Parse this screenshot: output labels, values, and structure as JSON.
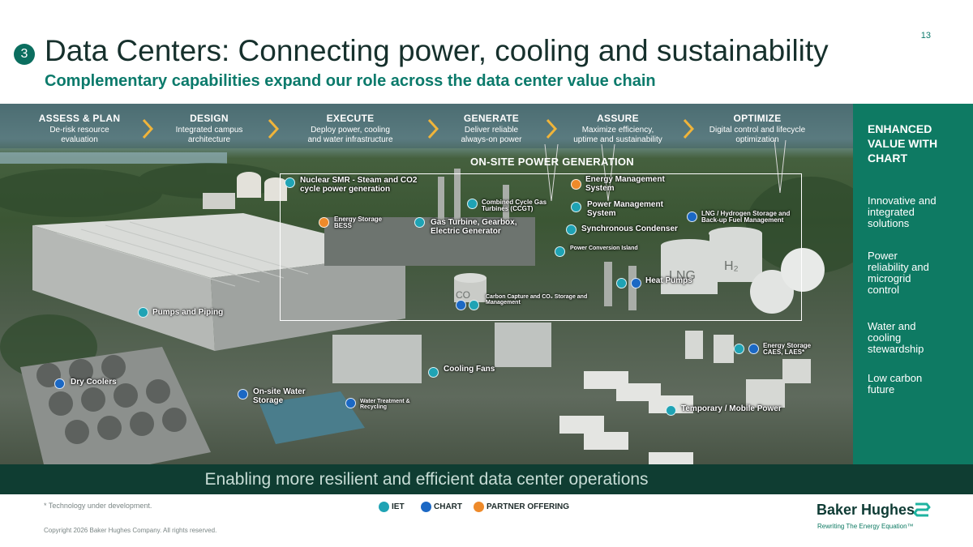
{
  "page_number": "13",
  "section_number": "3",
  "title": "Data Centers: Connecting power, cooling and sustainability",
  "subtitle": "Complementary capabilities expand our role across the data center value chain",
  "steps": [
    {
      "label": "ASSESS & PLAN",
      "desc1": "De-risk resource",
      "desc2": "evaluation"
    },
    {
      "label": "DESIGN",
      "desc1": "Integrated campus",
      "desc2": "architecture"
    },
    {
      "label": "EXECUTE",
      "desc1": "Deploy power, cooling",
      "desc2": "and water infrastructure"
    },
    {
      "label": "GENERATE",
      "desc1": "Deliver reliable",
      "desc2": "always-on power"
    },
    {
      "label": "ASSURE",
      "desc1": "Maximize efficiency,",
      "desc2": "uptime and sustainability"
    },
    {
      "label": "OPTIMIZE",
      "desc1": "Digital control and lifecycle",
      "desc2": "optimization"
    }
  ],
  "onsite_title": "ON-SITE POWER GENERATION",
  "labels": {
    "nuclear_1": "Nuclear SMR -  Steam and CO2",
    "nuclear_2": "cycle power generation",
    "ccgt_1": "Combined Cycle Gas",
    "ccgt_2": "Turbines (CCGT)",
    "ems_1": "Energy Management",
    "ems_2": "System",
    "pms_1": "Power Management",
    "pms_2": "System",
    "lng_1": "LNG / Hydrogen Storage and",
    "lng_2": "Back-up Fuel Management",
    "bess_1": "Energy Storage",
    "bess_2": "BESS",
    "gas_turbine_1": "Gas Turbine, Gearbox,",
    "gas_turbine_2": "Electric Generator",
    "sync_condenser": "Synchronous Condenser",
    "power_island": "Power Conversion Island",
    "heat_pumps": "Heat Pumps",
    "ccs_1": "Carbon Capture and CO₂ Storage and",
    "ccs_2": "Management",
    "pumps_piping": "Pumps and Piping",
    "energy_storage_caes_1": "Energy Storage",
    "energy_storage_caes_2": "CAES, LAES*",
    "cooling_fans": "Cooling Fans",
    "dry_coolers": "Dry Coolers",
    "water_storage_1": "On-site Water",
    "water_storage_2": "Storage",
    "water_treatment_1": "Water Treatment &",
    "water_treatment_2": "Recycling",
    "temp_power": "Temporary / Mobile Power"
  },
  "scene_texts": {
    "lng_tank": "LNG",
    "h2_tank": "H₂",
    "co_tank": "CO"
  },
  "bottom_banner": "Enabling more resilient and efficient data center operations",
  "side_panel": {
    "heading_1": "ENHANCED",
    "heading_2": "VALUE WITH",
    "heading_3": "CHART",
    "items": [
      [
        "Innovative and",
        "integrated",
        "solutions"
      ],
      [
        "Power",
        "reliability and",
        "microgrid",
        "control"
      ],
      [
        "Water and",
        "cooling",
        "stewardship"
      ],
      [
        "Low carbon",
        "future"
      ]
    ]
  },
  "footnote": "* Technology under development.",
  "legend": {
    "iet": "IET",
    "chart": "CHART",
    "partner": "PARTNER OFFERING"
  },
  "legend_colors": {
    "iet": "#1fa3b4",
    "chart": "#1b68c4",
    "partner": "#ee8a2a"
  },
  "copyright": "Copyright 2026 Baker Hughes Company. All rights reserved.",
  "brand": "Baker Hughes",
  "tagline": "Rewriting The Energy Equation™",
  "colors": {
    "brand_green": "#0e7a63",
    "dark_green": "#0f3d32",
    "title_dark": "#16302c"
  }
}
